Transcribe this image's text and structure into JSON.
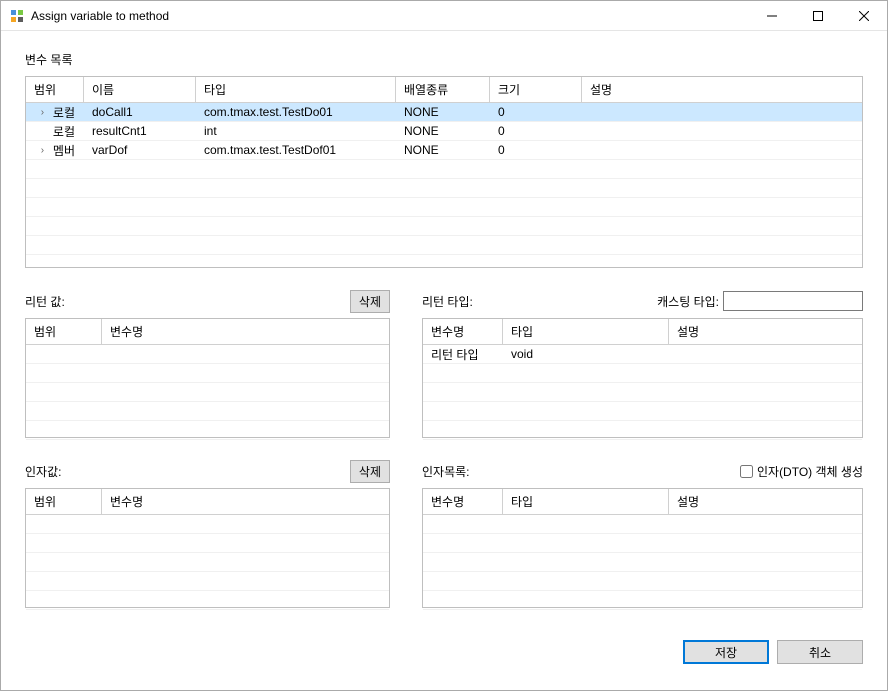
{
  "window": {
    "title": "Assign variable to method"
  },
  "variable_list": {
    "label": "변수 목록",
    "columns": {
      "scope": "범위",
      "name": "이름",
      "type": "타입",
      "array": "배열종류",
      "size": "크기",
      "desc": "설명"
    },
    "rows": [
      {
        "expand": "›",
        "scope": "로컬",
        "name": "doCall1",
        "type": "com.tmax.test.TestDo01",
        "array": "NONE",
        "size": "0",
        "desc": "",
        "selected": true
      },
      {
        "expand": "",
        "scope": "로컬",
        "name": "resultCnt1",
        "type": "int",
        "array": "NONE",
        "size": "0",
        "desc": "",
        "selected": false
      },
      {
        "expand": "›",
        "scope": "멤버",
        "name": "varDof",
        "type": "com.tmax.test.TestDof01",
        "array": "NONE",
        "size": "0",
        "desc": "",
        "selected": false
      }
    ]
  },
  "return_value": {
    "label": "리턴 값:",
    "delete_label": "삭제",
    "columns": {
      "scope": "범위",
      "varname": "변수명"
    }
  },
  "return_type": {
    "label": "리턴 타입:",
    "casting_label": "캐스팅 타입:",
    "casting_value": "",
    "columns": {
      "varname": "변수명",
      "type": "타입",
      "desc": "설명"
    },
    "rows": [
      {
        "varname": "리턴 타입",
        "type": "void",
        "desc": ""
      }
    ]
  },
  "arg_value": {
    "label": "인자값:",
    "delete_label": "삭제",
    "columns": {
      "scope": "범위",
      "varname": "변수명"
    }
  },
  "arg_list": {
    "label": "인자목록:",
    "checkbox_label": "인자(DTO) 객체 생성",
    "checkbox_checked": false,
    "columns": {
      "varname": "변수명",
      "type": "타입",
      "desc": "설명"
    }
  },
  "buttons": {
    "save": "저장",
    "cancel": "취소"
  }
}
